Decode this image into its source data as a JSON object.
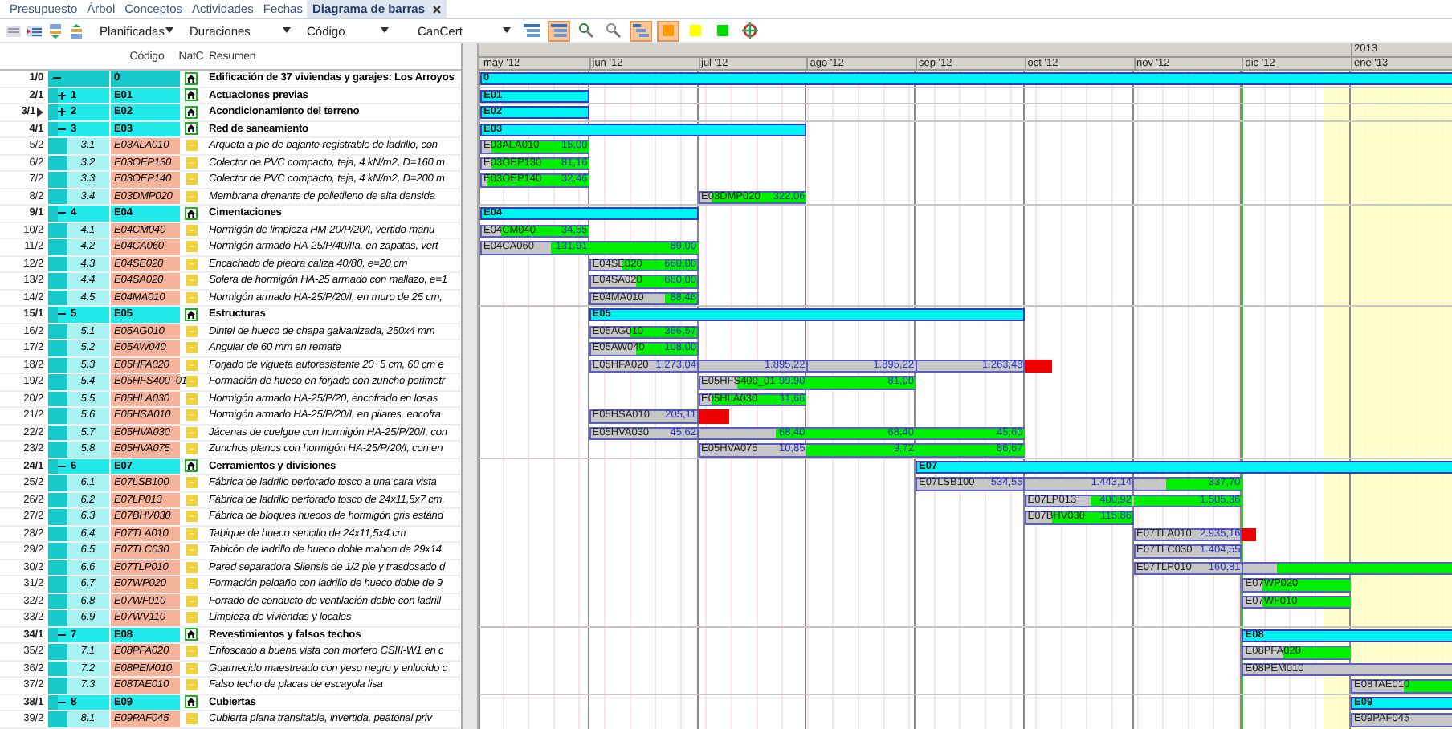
{
  "tabs": [
    {
      "label": "Presupuesto",
      "selected": false,
      "closable": false
    },
    {
      "label": "Árbol",
      "selected": false,
      "closable": false
    },
    {
      "label": "Conceptos",
      "selected": false,
      "closable": false
    },
    {
      "label": "Actividades",
      "selected": false,
      "closable": false
    },
    {
      "label": "Fechas",
      "selected": false,
      "closable": false
    },
    {
      "label": "Diagrama de barras",
      "selected": true,
      "closable": true
    }
  ],
  "toolbar": {
    "left_tools": [
      {
        "kind": "outdent"
      },
      {
        "kind": "indent"
      },
      {
        "kind": "move-down"
      },
      {
        "kind": "move-up"
      }
    ],
    "dropdowns": [
      {
        "value": "Planificadas"
      },
      {
        "value": "Duraciones"
      },
      {
        "value": "Código"
      },
      {
        "value": "CanCert"
      }
    ],
    "right_tools": [
      {
        "kind": "outline",
        "active": false
      },
      {
        "kind": "outline",
        "active": true
      },
      {
        "kind": "zoom-in",
        "active": false
      },
      {
        "kind": "zoom-out",
        "active": false
      },
      {
        "kind": "chart",
        "active": true
      },
      {
        "kind": "swatch",
        "color": "#ff9900",
        "active": true
      },
      {
        "kind": "swatch",
        "color": "#ffff00",
        "active": false
      },
      {
        "kind": "swatch",
        "color": "#00dd00",
        "active": false
      },
      {
        "kind": "target",
        "active": false
      }
    ]
  },
  "table": {
    "columns": [
      {
        "label": "Código"
      },
      {
        "label": "NatC"
      },
      {
        "label": "Resumen"
      }
    ],
    "rows": [
      {
        "id": "1/0",
        "kind": "root",
        "current": false,
        "expanded": true,
        "code": "0",
        "summary": "Edificación de 37 viviendas y garajes: Los Arroyos",
        "bar": {
          "kind": "summary",
          "label": "0"
        }
      },
      {
        "id": "2/1",
        "kind": "chapter",
        "current": false,
        "expanded": false,
        "outline": "1",
        "code": "E01",
        "summary": "Actuaciones previas",
        "bar": {
          "kind": "summary",
          "label": "E01"
        }
      },
      {
        "id": "3/1",
        "kind": "chapter",
        "current": true,
        "expanded": false,
        "outline": "2",
        "code": "E02",
        "summary": "Acondicionamiento del terreno",
        "bar": {
          "kind": "summary",
          "label": "E02"
        }
      },
      {
        "id": "4/1",
        "kind": "chapter",
        "current": false,
        "expanded": true,
        "outline": "3",
        "code": "E03",
        "summary": "Red de saneamiento",
        "bar": {
          "kind": "summary",
          "label": "E03"
        }
      },
      {
        "id": "5/2",
        "kind": "item",
        "current": false,
        "outline": "3.1",
        "code": "E03ALA010",
        "summary": "Arqueta a pie de bajante registrable de ladrillo, con",
        "bar": {
          "kind": "task",
          "label": "E03ALA010",
          "segments": [
            {
              "kind": "planned"
            },
            {
              "kind": "progress",
              "value": "15,00"
            }
          ]
        }
      },
      {
        "id": "6/2",
        "kind": "item",
        "current": false,
        "outline": "3.2",
        "code": "E03OEP130",
        "summary": "Colector de PVC compacto, teja, 4 kN/m2, D=160 m",
        "bar": {
          "kind": "task",
          "label": "E03OEP130",
          "segments": [
            {
              "kind": "planned"
            },
            {
              "kind": "progress",
              "value": "81,16"
            }
          ]
        }
      },
      {
        "id": "7/2",
        "kind": "item",
        "current": false,
        "outline": "3.3",
        "code": "E03OEP140",
        "summary": "Colector de PVC compacto, teja, 4 kN/m2, D=200 m",
        "bar": {
          "kind": "task",
          "label": "E03OEP140",
          "segments": [
            {
              "kind": "planned"
            },
            {
              "kind": "progress",
              "value": "32,46"
            }
          ]
        }
      },
      {
        "id": "8/2",
        "kind": "item",
        "current": false,
        "outline": "3.4",
        "code": "E03DMP020",
        "summary": "Membrana drenante de polietileno de alta densida",
        "bar": {
          "kind": "task",
          "label": "E03DMP020",
          "segments": [
            {
              "kind": "planned"
            },
            {
              "kind": "progress",
              "value": "322,06"
            }
          ]
        }
      },
      {
        "id": "9/1",
        "kind": "chapter",
        "current": false,
        "expanded": true,
        "outline": "4",
        "code": "E04",
        "summary": "Cimentaciones",
        "bar": {
          "kind": "summary",
          "label": "E04"
        }
      },
      {
        "id": "10/2",
        "kind": "item",
        "current": false,
        "outline": "4.1",
        "code": "E04CM040",
        "summary": "Hormigón de limpieza HM-20/P/20/I, vertido manu",
        "bar": {
          "kind": "task",
          "label": "E04CM040",
          "segments": [
            {
              "kind": "planned"
            },
            {
              "kind": "progress",
              "value": "34,55"
            }
          ]
        }
      },
      {
        "id": "11/2",
        "kind": "item",
        "current": false,
        "outline": "4.2",
        "code": "E04CA060",
        "summary": "Hormigón armado HA-25/P/40/IIa, en zapatas, vert",
        "bar": {
          "kind": "task",
          "label": "E04CA060",
          "segments": [
            {
              "kind": "planned"
            },
            {
              "kind": "progress",
              "value": "131,91"
            },
            {
              "kind": "progress",
              "value": "89,00"
            }
          ]
        }
      },
      {
        "id": "12/2",
        "kind": "item",
        "current": false,
        "outline": "4.3",
        "code": "E04SE020",
        "summary": "Encachado de piedra caliza 40/80, e=20 cm",
        "bar": {
          "kind": "task",
          "label": "E04SE020",
          "segments": [
            {
              "kind": "planned"
            },
            {
              "kind": "progress",
              "value": "660,00"
            }
          ]
        }
      },
      {
        "id": "13/2",
        "kind": "item",
        "current": false,
        "outline": "4.4",
        "code": "E04SA020",
        "summary": "Solera de hormigón HA-25 armado con mallazo, e=1",
        "bar": {
          "kind": "task",
          "label": "E04SA020",
          "segments": [
            {
              "kind": "planned"
            },
            {
              "kind": "progress",
              "value": "660,00"
            }
          ]
        }
      },
      {
        "id": "14/2",
        "kind": "item",
        "current": false,
        "outline": "4.5",
        "code": "E04MA010",
        "summary": "Hormigón armado HA-25/P/20/I, en muro de 25 cm,",
        "bar": {
          "kind": "task",
          "label": "E04MA010",
          "segments": [
            {
              "kind": "planned"
            },
            {
              "kind": "progress",
              "value": "88,46"
            }
          ]
        }
      },
      {
        "id": "15/1",
        "kind": "chapter",
        "current": false,
        "expanded": true,
        "outline": "5",
        "code": "E05",
        "summary": "Estructuras",
        "bar": {
          "kind": "summary",
          "label": "E05"
        }
      },
      {
        "id": "16/2",
        "kind": "item",
        "current": false,
        "outline": "5.1",
        "code": "E05AG010",
        "summary": "Dintel de hueco de chapa galvanizada, 250x4 mm",
        "bar": {
          "kind": "task",
          "label": "E05AG010",
          "segments": [
            {
              "kind": "planned"
            },
            {
              "kind": "progress",
              "value": "366,57"
            }
          ]
        }
      },
      {
        "id": "17/2",
        "kind": "item",
        "current": false,
        "outline": "5.2",
        "code": "E05AW040",
        "summary": "Angular de 60 mm en remate",
        "bar": {
          "kind": "task",
          "label": "E05AW040",
          "segments": [
            {
              "kind": "planned"
            },
            {
              "kind": "progress",
              "value": "108,00"
            }
          ]
        }
      },
      {
        "id": "18/2",
        "kind": "item",
        "current": false,
        "outline": "5.3",
        "code": "E05HFA020",
        "summary": "Forjado de vigueta autoresistente 20+5 cm, 60 cm e",
        "bar": {
          "kind": "task",
          "label": "E05HFA020",
          "segments": [
            {
              "kind": "planned",
              "value": "1.273,04"
            },
            {
              "kind": "planned",
              "value": "1.895,22"
            },
            {
              "kind": "planned",
              "value": "1.895,22"
            },
            {
              "kind": "planned",
              "value": "1.263,48"
            },
            {
              "kind": "overdue"
            }
          ]
        }
      },
      {
        "id": "19/2",
        "kind": "item",
        "current": false,
        "outline": "5.4",
        "code": "E05HFS400_01",
        "summary": "Formación de hueco en forjado con zuncho perimetr",
        "bar": {
          "kind": "task",
          "label": "E05HFS400_01",
          "segments": [
            {
              "kind": "planned"
            },
            {
              "kind": "progress",
              "value": "99,90"
            },
            {
              "kind": "progress",
              "value": "81,00"
            }
          ]
        }
      },
      {
        "id": "20/2",
        "kind": "item",
        "current": false,
        "outline": "5.5",
        "code": "E05HLA030",
        "summary": "Hormigón armado HA-25/P/20, encofrado en losas",
        "bar": {
          "kind": "task",
          "label": "E05HLA030",
          "segments": [
            {
              "kind": "planned"
            },
            {
              "kind": "progress",
              "value": "11,66"
            }
          ]
        }
      },
      {
        "id": "21/2",
        "kind": "item",
        "current": false,
        "outline": "5.6",
        "code": "E05HSA010",
        "summary": "Hormigón armado HA-25/P/20/I, en pilares, encofra",
        "bar": {
          "kind": "task",
          "label": "E05HSA010",
          "segments": [
            {
              "kind": "planned",
              "value": "205,11"
            },
            {
              "kind": "overdue"
            }
          ]
        }
      },
      {
        "id": "22/2",
        "kind": "item",
        "current": false,
        "outline": "5.7",
        "code": "E05HVA030",
        "summary": "Jácenas de cuelgue con hormigón HA-25/P/20/I, con",
        "bar": {
          "kind": "task",
          "label": "E05HVA030",
          "segments": [
            {
              "kind": "planned",
              "value": "45,62"
            },
            {
              "kind": "planned"
            },
            {
              "kind": "progress",
              "value": "68,40"
            },
            {
              "kind": "progress",
              "value": "68,40"
            },
            {
              "kind": "progress",
              "value": "45,60"
            }
          ]
        }
      },
      {
        "id": "23/2",
        "kind": "item",
        "current": false,
        "outline": "5.8",
        "code": "E05HVA075",
        "summary": "Zunchos planos con hormigón HA-25/P/20/I, con en",
        "bar": {
          "kind": "task",
          "label": "E05HVA075",
          "segments": [
            {
              "kind": "planned",
              "value": "10,85"
            },
            {
              "kind": "progress",
              "value": "9,72"
            },
            {
              "kind": "progress",
              "value": "86,67"
            }
          ]
        }
      },
      {
        "id": "24/1",
        "kind": "chapter",
        "current": false,
        "expanded": true,
        "outline": "6",
        "code": "E07",
        "summary": "Cerramientos y divisiones",
        "bar": {
          "kind": "summary",
          "label": "E07"
        }
      },
      {
        "id": "25/2",
        "kind": "item",
        "current": false,
        "outline": "6.1",
        "code": "E07LSB100",
        "summary": "Fábrica de ladrillo perforado tosco a una cara vista",
        "bar": {
          "kind": "task",
          "label": "E07LSB100",
          "segments": [
            {
              "kind": "planned",
              "value": "534,55"
            },
            {
              "kind": "planned",
              "value": "1.443,14"
            },
            {
              "kind": "planned"
            },
            {
              "kind": "progress",
              "value": "337,70"
            }
          ]
        }
      },
      {
        "id": "26/2",
        "kind": "item",
        "current": false,
        "outline": "6.2",
        "code": "E07LP013",
        "summary": "Fábrica de ladrillo perforado tosco de 24x11,5x7 cm,",
        "bar": {
          "kind": "task",
          "label": "E07LP013",
          "segments": [
            {
              "kind": "planned"
            },
            {
              "kind": "progress",
              "value": "400,92"
            },
            {
              "kind": "progress",
              "value": "1.505,36"
            }
          ]
        }
      },
      {
        "id": "27/2",
        "kind": "item",
        "current": false,
        "outline": "6.3",
        "code": "E07BHV030",
        "summary": "Fábrica de bloques huecos de hormigón gris estánd",
        "bar": {
          "kind": "task",
          "label": "E07BHV030",
          "segments": [
            {
              "kind": "planned"
            },
            {
              "kind": "progress",
              "value": "115,86"
            }
          ]
        }
      },
      {
        "id": "28/2",
        "kind": "item",
        "current": false,
        "outline": "6.4",
        "code": "E07TLA010",
        "summary": "Tabique de hueco sencillo de 24x11,5x4 cm",
        "bar": {
          "kind": "task",
          "label": "E07TLA010",
          "segments": [
            {
              "kind": "planned",
              "value": "2.935,16"
            },
            {
              "kind": "overdue"
            }
          ]
        }
      },
      {
        "id": "29/2",
        "kind": "item",
        "current": false,
        "outline": "6.5",
        "code": "E07TLC030",
        "summary": "Tabicón de ladrillo de hueco doble mahon de 29x14",
        "bar": {
          "kind": "task",
          "label": "E07TLC030",
          "segments": [
            {
              "kind": "planned",
              "value": "1.404,55"
            }
          ]
        }
      },
      {
        "id": "30/2",
        "kind": "item",
        "current": false,
        "outline": "6.6",
        "code": "E07TLP010",
        "summary": "Pared separadora Silensis de 1/2 pie y trasdosado d",
        "bar": {
          "kind": "task",
          "label": "E07TLP010",
          "segments": [
            {
              "kind": "planned",
              "value": "160,81"
            },
            {
              "kind": "planned"
            },
            {
              "kind": "progress"
            }
          ]
        }
      },
      {
        "id": "31/2",
        "kind": "item",
        "current": false,
        "outline": "6.7",
        "code": "E07WP020",
        "summary": "Formación peldaño con ladrillo de hueco doble de 9",
        "bar": {
          "kind": "task",
          "label": "E07WP020",
          "segments": [
            {
              "kind": "planned"
            },
            {
              "kind": "progress"
            }
          ]
        }
      },
      {
        "id": "32/2",
        "kind": "item",
        "current": false,
        "outline": "6.8",
        "code": "E07WF010",
        "summary": "Forrado de conducto de ventilación doble con ladrill",
        "bar": {
          "kind": "task",
          "label": "E07WF010",
          "segments": [
            {
              "kind": "planned"
            },
            {
              "kind": "progress"
            }
          ]
        }
      },
      {
        "id": "33/2",
        "kind": "item",
        "current": false,
        "outline": "6.9",
        "code": "E07WV110",
        "summary": "Limpieza de viviendas y locales"
      },
      {
        "id": "34/1",
        "kind": "chapter",
        "current": false,
        "expanded": true,
        "outline": "7",
        "code": "E08",
        "summary": "Revestimientos y falsos techos",
        "bar": {
          "kind": "summary",
          "label": "E08"
        }
      },
      {
        "id": "35/2",
        "kind": "item",
        "current": false,
        "outline": "7.1",
        "code": "E08PFA020",
        "summary": "Enfoscado a buena vista con mortero CSIII-W1 en c",
        "bar": {
          "kind": "task",
          "label": "E08PFA020",
          "segments": [
            {
              "kind": "planned"
            },
            {
              "kind": "progress"
            }
          ]
        }
      },
      {
        "id": "36/2",
        "kind": "item",
        "current": false,
        "outline": "7.2",
        "code": "E08PEM010",
        "summary": "Guarnecido maestreado con yeso negro y enlucido c",
        "bar": {
          "kind": "task",
          "label": "E08PEM010",
          "segments": [
            {
              "kind": "planned"
            }
          ]
        }
      },
      {
        "id": "37/2",
        "kind": "item",
        "current": false,
        "outline": "7.3",
        "code": "E08TAE010",
        "summary": "Falso techo de placas de escayola lisa",
        "bar": {
          "kind": "task",
          "label": "E08TAE010",
          "segments": [
            {
              "kind": "planned"
            },
            {
              "kind": "progress"
            }
          ]
        }
      },
      {
        "id": "38/1",
        "kind": "chapter",
        "current": false,
        "expanded": true,
        "outline": "8",
        "code": "E09",
        "summary": "Cubiertas",
        "bar": {
          "kind": "summary",
          "label": "E09"
        }
      },
      {
        "id": "39/2",
        "kind": "item",
        "current": false,
        "outline": "8.1",
        "code": "E09PAF045",
        "summary": "Cubierta plana transitable, invertida, peatonal priv",
        "bar": {
          "kind": "task",
          "label": "E09PAF045",
          "segments": [
            {
              "kind": "planned"
            }
          ]
        }
      }
    ]
  },
  "gantt": {
    "months": [
      {
        "label": "may '12"
      },
      {
        "label": "jun '12"
      },
      {
        "label": "jul '12"
      },
      {
        "label": "ago '12"
      },
      {
        "label": "sep '12"
      },
      {
        "label": "oct '12"
      },
      {
        "label": "nov '12"
      },
      {
        "label": "dic '12"
      },
      {
        "label": "ene '13",
        "year": "2013"
      }
    ]
  }
}
